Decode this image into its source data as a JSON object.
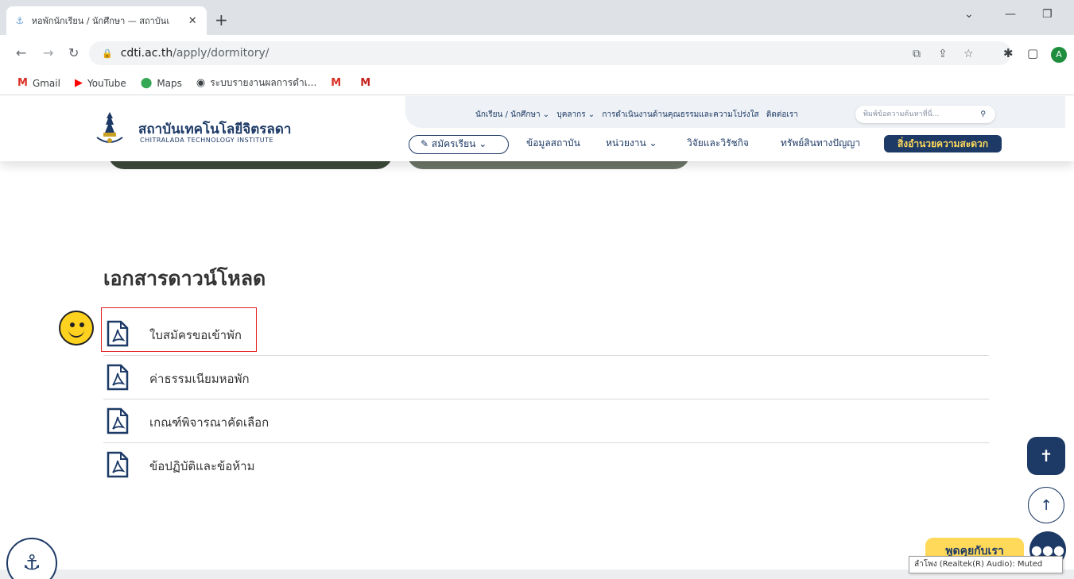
{
  "browser": {
    "tab_title": "หอพักนักเรียน / นักศึกษา — สถาบันเ",
    "new_tab_symbol": "+",
    "url_host": "cdti.ac.th",
    "url_path": "/apply/dormitory/",
    "avatar_letter": "A",
    "bookmarks": [
      {
        "label": "Gmail",
        "icon": "gmail-icon"
      },
      {
        "label": "YouTube",
        "icon": "youtube-icon"
      },
      {
        "label": "Maps",
        "icon": "maps-icon"
      },
      {
        "label": "ระบบรายงานผลการดำเ...",
        "icon": "globe-icon"
      }
    ]
  },
  "site": {
    "logo_th": "สถาบันเทคโนโลยีจิตรลดา",
    "logo_en": "CHITRALADA TECHNOLOGY INSTITUTE",
    "top_nav": [
      "นักเรียน / นักศึกษา ⌄",
      "บุคลากร ⌄",
      "การดำเนินงานด้านคุณธรรมและความโปร่งใส",
      "ติดต่อเรา"
    ],
    "search_placeholder": "พิมพ์ข้อความค้นหาที่นี่...",
    "apply_label": "สมัครเรียน",
    "main_nav": [
      "ข้อมูลสถาบัน",
      "หน่วยงาน ⌄",
      "วิจัยและวิรัชกิจ",
      "ทรัพย์สินทางปัญญา"
    ],
    "facility_label": "สิ่งอำนวยความสะดวก"
  },
  "downloads": {
    "title": "เอกสารดาวน์โหลด",
    "items": [
      {
        "label": "ใบสมัครขอเข้าพัก"
      },
      {
        "label": "ค่าธรรมเนียมหอพัก"
      },
      {
        "label": "เกณฑ์พิจารณาคัดเลือก"
      },
      {
        "label": "ข้อปฏิบัติและข้อห้าม"
      }
    ]
  },
  "widgets": {
    "chat_label": "พูดคุยกับเรา",
    "tooltip": "ลำโพง (Realtek(R) Audio): Muted"
  },
  "colors": {
    "brand_navy": "#1d3a66",
    "brand_yellow": "#ffd95a",
    "highlight_red": "#e02020"
  }
}
